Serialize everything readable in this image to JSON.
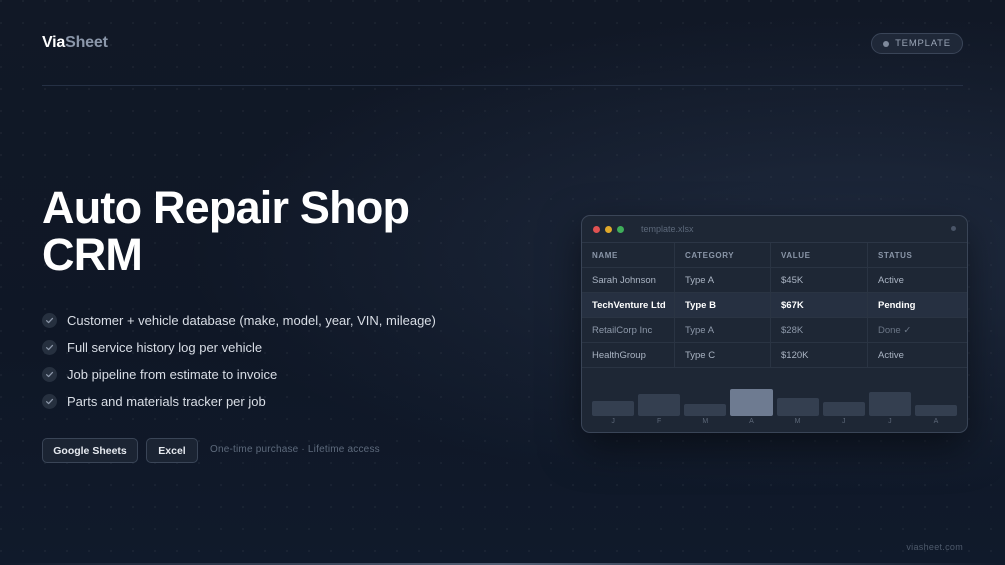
{
  "header": {
    "logo_part1": "Via",
    "logo_part2": "Sheet",
    "badge_label": "TEMPLATE"
  },
  "hero": {
    "title_line1": "Auto Repair Shop",
    "title_line2": "CRM"
  },
  "features": [
    "Customer + vehicle database (make, model, year, VIN, mileage)",
    "Full service history log per vehicle",
    "Job pipeline from estimate to invoice",
    "Parts and materials tracker per job"
  ],
  "actions": {
    "google_sheets_label": "Google Sheets",
    "excel_label": "Excel",
    "purchase_note": "One-time purchase · Lifetime access"
  },
  "footer": {
    "url": "viasheet.com"
  },
  "preview": {
    "filename": "template.xlsx",
    "window_dots": [
      "#e05252",
      "#e0a92a",
      "#3fae5a"
    ],
    "columns": [
      "NAME",
      "CATEGORY",
      "VALUE",
      "STATUS"
    ],
    "rows": [
      [
        "Sarah Johnson",
        "Type A",
        "$45K",
        "Active"
      ],
      [
        "TechVenture Ltd",
        "Type B",
        "$67K",
        "Pending"
      ],
      [
        "RetailCorp Inc",
        "Type A",
        "$28K",
        "Done ✓"
      ],
      [
        "HealthGroup",
        "Type C",
        "$120K",
        "Active"
      ]
    ],
    "highlighted_row": 1
  },
  "chart_data": {
    "type": "bar",
    "categories": [
      "J",
      "F",
      "M",
      "A",
      "M",
      "J",
      "J",
      "A"
    ],
    "values": [
      0.38,
      0.55,
      0.3,
      0.68,
      0.45,
      0.36,
      0.6,
      0.28
    ],
    "highlight_index": 3,
    "title": "",
    "xlabel": "",
    "ylabel": "",
    "ylim": [
      0,
      1
    ]
  },
  "colors": {
    "background": "#111826",
    "accent_text": "#ffffff",
    "muted_text": "#8b97aa",
    "bar": "#343f50",
    "bar_highlight": "#6e7b91"
  },
  "icons": {
    "feature": "check-icon",
    "badge": "dot-icon"
  }
}
